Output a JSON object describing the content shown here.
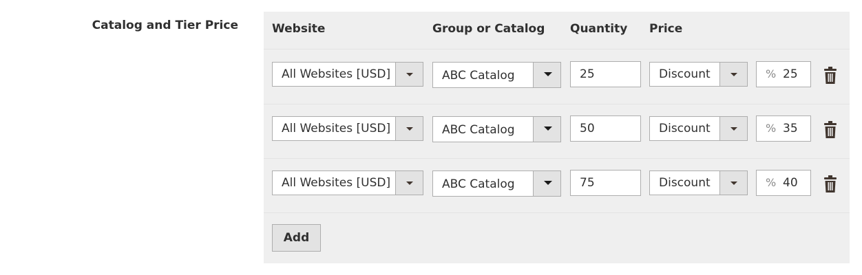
{
  "field_label": "Catalog and Tier Price",
  "columns": {
    "website": "Website",
    "group": "Group or Catalog",
    "quantity": "Quantity",
    "price": "Price"
  },
  "rows": [
    {
      "website": "All Websites [USD]",
      "group": "ABC Catalog",
      "quantity": "25",
      "price_type": "Discount",
      "percent_symbol": "%",
      "price_value": "25"
    },
    {
      "website": "All Websites [USD]",
      "group": "ABC Catalog",
      "quantity": "50",
      "price_type": "Discount",
      "percent_symbol": "%",
      "price_value": "35"
    },
    {
      "website": "All Websites [USD]",
      "group": "ABC Catalog",
      "quantity": "75",
      "price_type": "Discount",
      "percent_symbol": "%",
      "price_value": "40"
    }
  ],
  "add_label": "Add",
  "icons": {
    "delete": "trash-icon",
    "dropdown": "chevron-down-icon"
  },
  "colors": {
    "panel_bg": "#efefef",
    "arrow_bg": "#e3e3e3",
    "border": "#adadad",
    "text": "#303030",
    "trash": "#41362f"
  }
}
